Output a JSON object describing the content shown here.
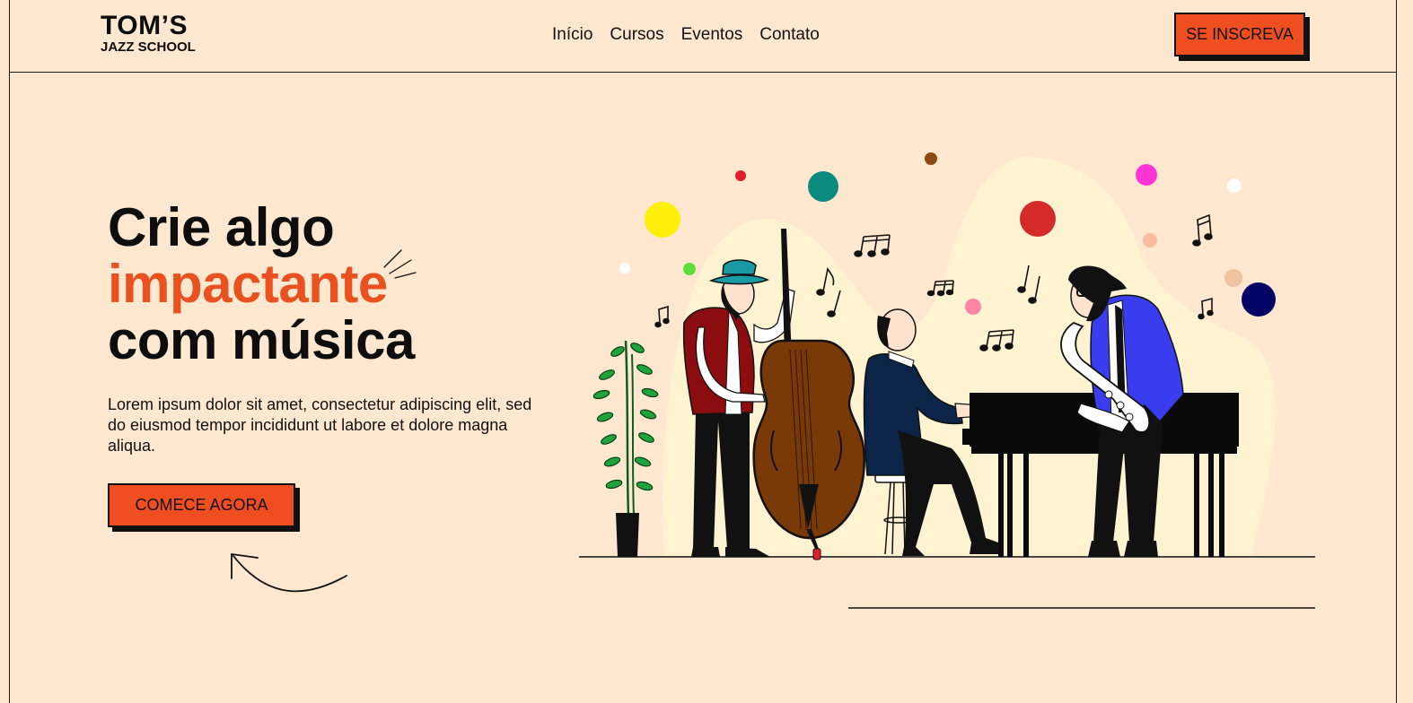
{
  "header": {
    "logo": {
      "main": "TOM’S",
      "sub": "JAZZ SCHOOL"
    },
    "nav": [
      {
        "label": "Início"
      },
      {
        "label": "Cursos"
      },
      {
        "label": "Eventos"
      },
      {
        "label": "Contato"
      }
    ],
    "signup_label": "SE INSCREVA"
  },
  "hero": {
    "headline": {
      "line1": "Crie algo",
      "accent": "impactante",
      "line3": "com música"
    },
    "lead": "Lorem ipsum dolor sit amet, consectetur adipiscing elit, sed do eiusmod tempor incididunt ut labore et dolore magna aliqua.",
    "cta_label": "COMECE AGORA"
  },
  "colors": {
    "background": "#ffe7d0",
    "accent": "#ef4f20",
    "text": "#0d0d0d"
  },
  "illustration": {
    "icons": [
      "sparkle-lines-icon",
      "curved-arrow-icon",
      "music-note-icon"
    ]
  }
}
